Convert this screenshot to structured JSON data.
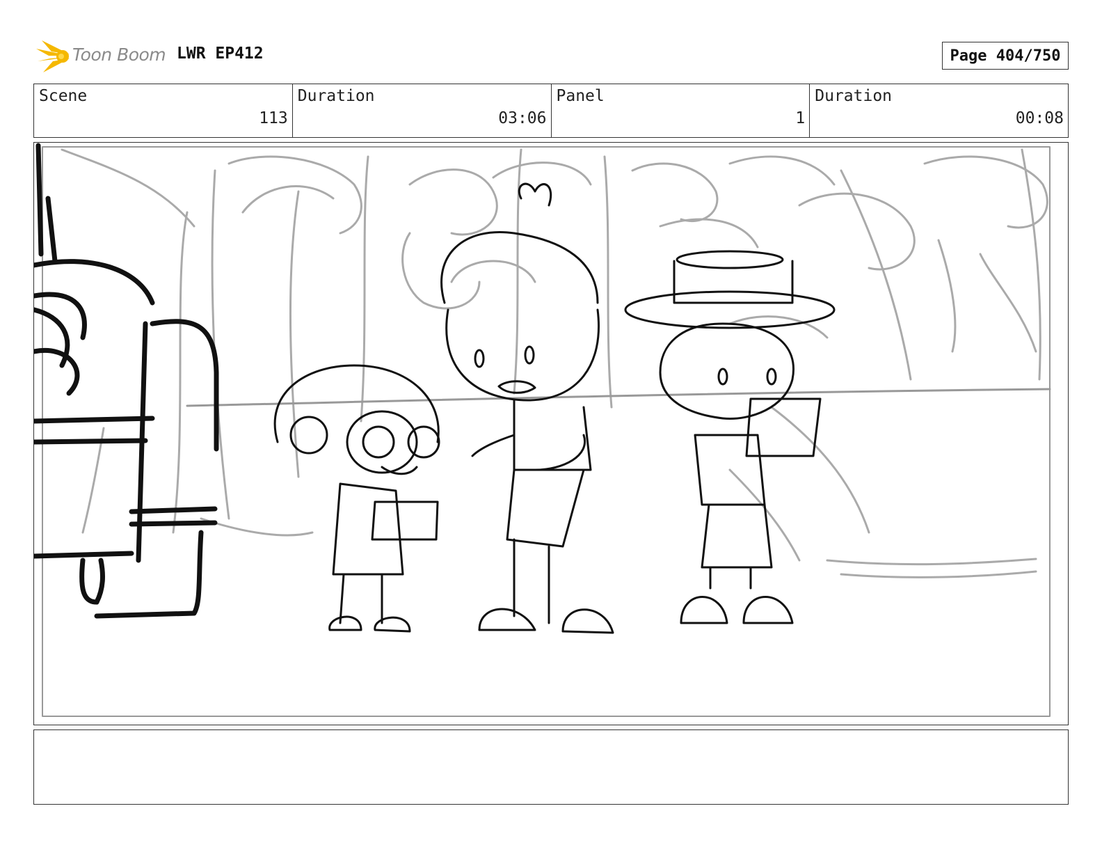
{
  "header": {
    "logo_text": "Toon Boom",
    "logo_icon": "toon-boom-burst-icon",
    "project": "LWR EP412",
    "page": "Page 404/750"
  },
  "info": [
    {
      "label": "Scene",
      "value": "113"
    },
    {
      "label": "Duration",
      "value": "03:06"
    },
    {
      "label": "Panel",
      "value": "1"
    },
    {
      "label": "Duration",
      "value": "00:08"
    }
  ],
  "colors": {
    "logo_burst": "#f5b800",
    "logo_text": "#8a8a8a",
    "sketch_line": "#111111",
    "background_line": "#a8a8a8",
    "border": "#333333"
  },
  "panel": {
    "description": "",
    "notes": ""
  }
}
